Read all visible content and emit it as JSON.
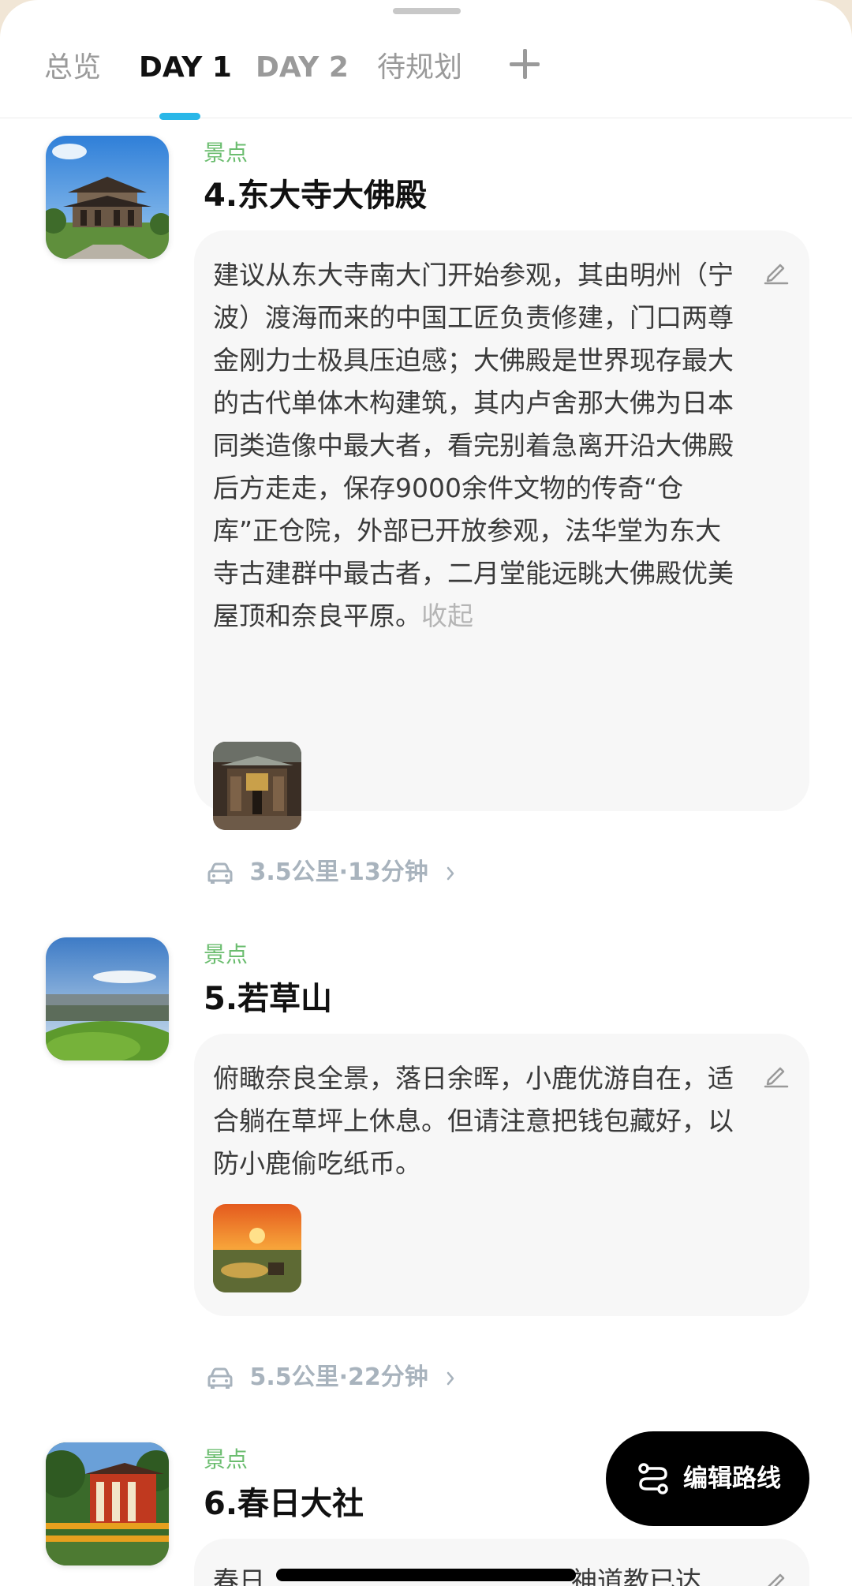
{
  "tabs": [
    {
      "label": "总览"
    },
    {
      "label": "DAY 1"
    },
    {
      "label": "DAY 2"
    },
    {
      "label": "待规划"
    }
  ],
  "active_tab": "DAY 1",
  "add_tab_icon": "plus-icon",
  "accent_color": "#29b7e8",
  "category_color": "#6bbd6f",
  "items": [
    {
      "category": "景点",
      "title": "4.东大寺大佛殿",
      "description": "建议从东大寺南大门开始参观，其由明州（宁波）渡海而来的中国工匠负责修建，门口两尊金刚力士极具压迫感；大佛殿是世界现存最大的古代单体木构建筑，其内卢舍那大佛为日本同类造像中最大者，看完别着急离开沿大佛殿后方走走，保存9000余件文物的传奇“仓库”正仓院，外部已开放参观，法华堂为东大寺古建群中最古者，二月堂能远眺大佛殿优美屋顶和奈良平原。",
      "collapse_label": "收起",
      "thumbnail": "temple-hall-photo",
      "photo": "temple-detail-photo"
    },
    {
      "category": "景点",
      "title": "5.若草山",
      "description": "俯瞰奈良全景，落日余晖，小鹿优游自在，适合躺在草坪上休息。但请注意把钱包藏好，以防小鹿偷吃纸币。",
      "thumbnail": "grassy-hill-photo",
      "photo": "sunset-view-photo"
    },
    {
      "category": "景点",
      "title": "6.春日大社",
      "description_visible": "春日",
      "description_tail": "神道教已达",
      "thumbnail": "shrine-photo"
    }
  ],
  "routes": [
    {
      "text": "3.5公里·13分钟",
      "icon": "car-icon"
    },
    {
      "text": "5.5公里·22分钟",
      "icon": "car-icon"
    }
  ],
  "fab": {
    "label": "编辑路线",
    "icon": "route-icon"
  }
}
